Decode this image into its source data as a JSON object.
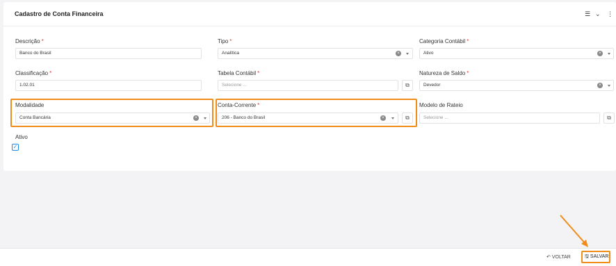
{
  "card": {
    "title": "Cadastro de Conta Financeira",
    "header_icons": [
      "list-icon",
      "chevron-down-icon",
      "more-vert-icon"
    ]
  },
  "fields": {
    "descricao": {
      "label": "Descrição",
      "required": "*",
      "value": "Banco do Brasil"
    },
    "tipo": {
      "label": "Tipo",
      "required": "*",
      "value": "Analítica"
    },
    "categoria_contabil": {
      "label": "Categoria Contábil",
      "required": "*",
      "value": "Ativo"
    },
    "classificacao": {
      "label": "Classificação",
      "required": "*",
      "value": "1.02.01"
    },
    "tabela_contabil": {
      "label": "Tabela Contábil",
      "required": "*",
      "placeholder": "Selecione ..."
    },
    "natureza_saldo": {
      "label": "Natureza de Saldo",
      "required": "*",
      "value": "Devedor"
    },
    "modalidade": {
      "label": "Modalidade",
      "value": "Conta Bancária"
    },
    "conta_corrente": {
      "label": "Conta-Corrente",
      "required": "*",
      "value": "206 - Banco do Brasil"
    },
    "modelo_rateio": {
      "label": "Modelo de Rateio",
      "placeholder": "Selecione ..."
    },
    "ativo": {
      "label": "Ativo",
      "checked": true
    }
  },
  "footer": {
    "voltar_label": "VOLTAR",
    "salvar_label": "SALVAR"
  },
  "colors": {
    "highlight": "#f08c1a",
    "required": "#e53935",
    "checkbox": "#1e88e5"
  }
}
